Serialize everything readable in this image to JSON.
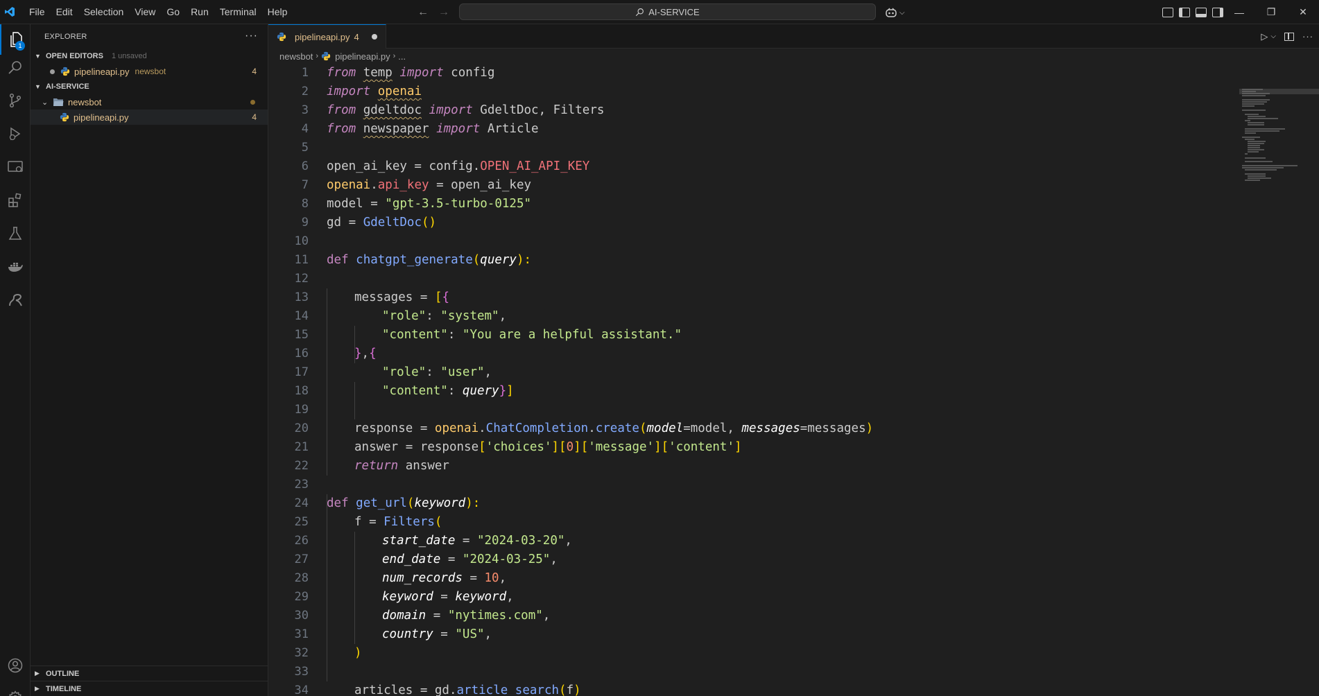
{
  "menu": [
    "File",
    "Edit",
    "Selection",
    "View",
    "Go",
    "Run",
    "Terminal",
    "Help"
  ],
  "search": {
    "label": "AI-SERVICE"
  },
  "activity": {
    "explorer_badge": "1"
  },
  "sidebar": {
    "title": "EXPLORER",
    "open_editors": {
      "label": "OPEN EDITORS",
      "sub": "1 unsaved"
    },
    "open_file": {
      "name": "pipelineapi.py",
      "desc": "newsbot",
      "count": "4"
    },
    "workspace": {
      "label": "AI-SERVICE"
    },
    "folder": {
      "name": "newsbot"
    },
    "file": {
      "name": "pipelineapi.py",
      "count": "4"
    },
    "outline": "OUTLINE",
    "timeline": "TIMELINE"
  },
  "editor": {
    "tab": {
      "name": "pipelineapi.py",
      "count": "4"
    },
    "breadcrumb": {
      "folder": "newsbot",
      "file": "pipelineapi.py",
      "more": "..."
    }
  },
  "code_lines": [
    {
      "n": "1"
    },
    {
      "n": "2"
    },
    {
      "n": "3"
    },
    {
      "n": "4"
    },
    {
      "n": "5"
    },
    {
      "n": "6"
    },
    {
      "n": "7"
    },
    {
      "n": "8"
    },
    {
      "n": "9"
    },
    {
      "n": "10"
    },
    {
      "n": "11"
    },
    {
      "n": "12"
    },
    {
      "n": "13"
    },
    {
      "n": "14"
    },
    {
      "n": "15"
    },
    {
      "n": "16"
    },
    {
      "n": "17"
    },
    {
      "n": "18"
    },
    {
      "n": "19"
    },
    {
      "n": "20"
    },
    {
      "n": "21"
    },
    {
      "n": "22"
    },
    {
      "n": "23"
    },
    {
      "n": "24"
    },
    {
      "n": "25"
    },
    {
      "n": "26"
    },
    {
      "n": "27"
    },
    {
      "n": "28"
    },
    {
      "n": "29"
    },
    {
      "n": "30"
    },
    {
      "n": "31"
    },
    {
      "n": "32"
    },
    {
      "n": "33"
    },
    {
      "n": "34"
    }
  ],
  "code": {
    "l1": [
      "from",
      " ",
      "temp",
      " ",
      "import",
      " config"
    ],
    "l2": [
      "import",
      " ",
      "openai"
    ],
    "l3": [
      "from",
      " ",
      "gdeltdoc",
      " ",
      "import",
      " GdeltDoc, Filters"
    ],
    "l4": [
      "from",
      " ",
      "newspaper",
      " ",
      "import",
      " Article"
    ],
    "l6": [
      "open_ai_key = config.",
      "OPEN_AI_API_KEY"
    ],
    "l7": [
      "openai",
      ".",
      "api_key",
      " = open_ai_key"
    ],
    "l8": [
      "model = ",
      "\"gpt-3.5-turbo-0125\""
    ],
    "l9": [
      "gd = ",
      "GdeltDoc",
      "()"
    ],
    "l11": [
      "def",
      " ",
      "chatgpt_generate",
      "(",
      "query",
      "):"
    ],
    "l13": [
      "messages = ",
      "[",
      "{"
    ],
    "l14": [
      "\"role\"",
      ": ",
      "\"system\"",
      ","
    ],
    "l15": [
      "\"content\"",
      ": ",
      "\"You are a helpful assistant.\""
    ],
    "l16": [
      "}",
      ",",
      "{"
    ],
    "l17": [
      "\"role\"",
      ": ",
      "\"user\"",
      ","
    ],
    "l18": [
      "\"content\"",
      ": ",
      "query",
      "}",
      "]"
    ],
    "l20": [
      "response = ",
      "openai",
      ".",
      "ChatCompletion",
      ".",
      "create",
      "(",
      "model",
      "=model, ",
      "messages",
      "=messages",
      ")"
    ],
    "l21": [
      "answer = response",
      "[",
      "'choices'",
      "]",
      "[",
      "0",
      "]",
      "[",
      "'message'",
      "]",
      "[",
      "'content'",
      "]"
    ],
    "l22": [
      "return",
      " answer"
    ],
    "l24": [
      "def",
      " ",
      "get_url",
      "(",
      "keyword",
      "):"
    ],
    "l25": [
      "f = ",
      "Filters",
      "("
    ],
    "l26": [
      "start_date",
      " = ",
      "\"2024-03-20\"",
      ","
    ],
    "l27": [
      "end_date",
      " = ",
      "\"2024-03-25\"",
      ","
    ],
    "l28": [
      "num_records",
      " = ",
      "10",
      ","
    ],
    "l29": [
      "keyword",
      " = ",
      "keyword",
      ","
    ],
    "l30": [
      "domain",
      " = ",
      "\"nytimes.com\"",
      ","
    ],
    "l31": [
      "country",
      " = ",
      "\"US\"",
      ","
    ],
    "l32": [
      ")"
    ],
    "l34": [
      "articles = gd.",
      "article_search",
      "(",
      "f",
      ")"
    ]
  },
  "colors": {
    "accent": "#0078d4",
    "modified": "#e2c08d",
    "background": "#1f1f1f"
  }
}
